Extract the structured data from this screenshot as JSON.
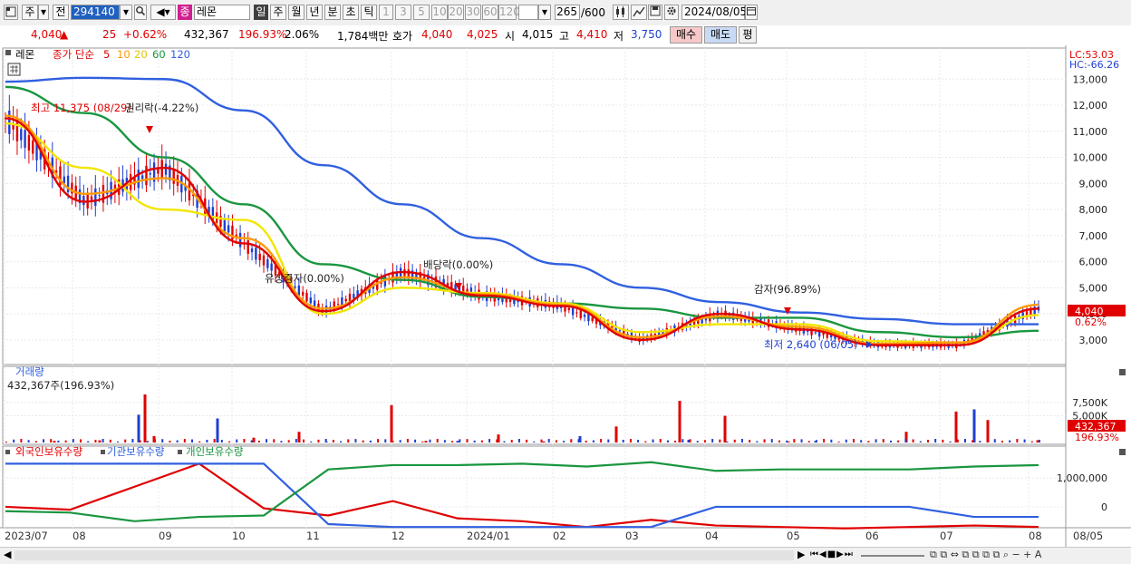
{
  "toolbar": {
    "market": "주",
    "scope": "전",
    "code": "294140",
    "badge": "종",
    "stock_name": "레몬",
    "period_buttons": [
      "일",
      "주",
      "월",
      "년",
      "분",
      "초",
      "틱"
    ],
    "interval_buttons": [
      "1",
      "3",
      "5",
      "10",
      "20",
      "30",
      "60",
      "120"
    ],
    "count": "265",
    "count_total": "/600",
    "date": "2024/08/05"
  },
  "quote": {
    "price": "4,040",
    "change": "25",
    "change_pct": "+0.62%",
    "volume": "432,367",
    "volume_ratio": "196.93%",
    "turnover_pct": "2.06%",
    "amount": "1,784백만",
    "ask_label": "호가",
    "ask1": "4,040",
    "ask2": "4,025",
    "open_label": "시",
    "open": "4,015",
    "high_label": "고",
    "high": "4,410",
    "low_label": "저",
    "low": "3,750",
    "buy": "매수",
    "sell": "매도",
    "eval": "평"
  },
  "price_panel": {
    "legend_name": "레몬",
    "legend_ma": "종가 단순",
    "ma_periods": [
      "5",
      "10",
      "20",
      "60",
      "120"
    ],
    "ma_colors": [
      "#e00000",
      "#ff9900",
      "#f2e600",
      "#1a9640",
      "#3060e0"
    ],
    "lc": "LC:53.03",
    "hc": "HC:-66.26",
    "last_price_label": "4,040",
    "last_change_label": "0.62%",
    "annotations": {
      "high": "최고 11,375 (08/29)",
      "div1": "권리락(-4.22%)",
      "div2": "유상증자(0.00%)",
      "div3": "배당락(0.00%)",
      "div4": "감자(96.89%)",
      "low": "최저 2,640 (06/05)"
    }
  },
  "volume_panel": {
    "title": "거래량",
    "value": "432,367주(196.93%)",
    "last_label": "432,367",
    "last_pct": "196.93%"
  },
  "holding_panel": {
    "labels": [
      "외국인보유수량",
      "기관보유수량",
      "개인보유수량"
    ],
    "colors": [
      "#e00000",
      "#3060e0",
      "#1a9640"
    ]
  },
  "x_axis": {
    "labels": [
      "2023/07",
      "08",
      "09",
      "10",
      "11",
      "12",
      "2024/01",
      "02",
      "03",
      "04",
      "05",
      "06",
      "07",
      "08"
    ],
    "last_date": "08/05"
  },
  "chart_data": [
    {
      "type": "line",
      "title": "",
      "ylabel": "",
      "ylim": [
        2300,
        13600
      ],
      "y_ticks": [
        "3,000",
        "4,000",
        "5,000",
        "6,000",
        "7,000",
        "8,000",
        "9,000",
        "10,000",
        "11,000",
        "12,000",
        "13,000"
      ],
      "y_tick_values": [
        3000,
        4000,
        5000,
        6000,
        7000,
        8000,
        9000,
        10000,
        11000,
        12000,
        13000
      ],
      "x": [
        "2023-07",
        "08",
        "09",
        "10",
        "11",
        "12",
        "2024-01",
        "02",
        "03",
        "04",
        "05",
        "06",
        "07",
        "08"
      ],
      "series": [
        {
          "name": "5",
          "values": [
            11500,
            8300,
            9600,
            6700,
            4100,
            5600,
            4700,
            4300,
            3000,
            4000,
            3400,
            2800,
            2800,
            4200
          ]
        },
        {
          "name": "10",
          "values": [
            11600,
            8600,
            9200,
            6900,
            4200,
            5400,
            4750,
            4350,
            3100,
            3900,
            3500,
            2850,
            2900,
            4350
          ]
        },
        {
          "name": "20",
          "values": [
            11300,
            9600,
            8000,
            7600,
            4000,
            5000,
            4800,
            4400,
            3300,
            3600,
            3600,
            2950,
            2900,
            3950
          ]
        },
        {
          "name": "60",
          "values": [
            12700,
            11700,
            10000,
            8200,
            5900,
            5300,
            4650,
            4400,
            4200,
            3850,
            3850,
            3300,
            3100,
            3350
          ]
        },
        {
          "name": "120",
          "values": [
            12900,
            13050,
            13000,
            11800,
            9700,
            8200,
            6900,
            5900,
            5000,
            4450,
            4050,
            3800,
            3600,
            3600
          ]
        }
      ]
    },
    {
      "type": "bar",
      "title": "거래량",
      "ylim": [
        0,
        9000
      ],
      "y_ticks": [
        "5,000K",
        "7,500K"
      ],
      "y_tick_values": [
        5000,
        7500
      ],
      "values_k": [
        300,
        400,
        5200,
        9000,
        1200,
        4500,
        900,
        2000,
        200,
        7000,
        300,
        300,
        1500,
        200,
        1200,
        3000,
        7800,
        500,
        5000,
        200,
        300,
        2000,
        5800,
        6200,
        4200,
        432
      ]
    },
    {
      "type": "line",
      "title": "외국인보유수량 기관보유수량 개인보유수량",
      "ylim": [
        -600000,
        1700000
      ],
      "y_ticks": [
        "0",
        "1,000,000"
      ],
      "y_tick_values": [
        0,
        1000000
      ],
      "series": [
        {
          "name": "외국인보유수량",
          "values": [
            0,
            -100000,
            700000,
            1500000,
            -50000,
            -300000,
            200000,
            -400000,
            -500000,
            -700000,
            -450000,
            -650000,
            -700000,
            -750000,
            -700000,
            -650000,
            -700000
          ]
        },
        {
          "name": "기관보유수량",
          "values": [
            1500000,
            1500000,
            1500000,
            1500000,
            1500000,
            -600000,
            -700000,
            -700000,
            -700000,
            -700000,
            -700000,
            0,
            0,
            0,
            0,
            -350000,
            -350000
          ]
        },
        {
          "name": "개인보유수량",
          "values": [
            -150000,
            -200000,
            -500000,
            -350000,
            -300000,
            1300000,
            1450000,
            1450000,
            1500000,
            1400000,
            1550000,
            1250000,
            1300000,
            1300000,
            1300000,
            1400000,
            1450000
          ]
        }
      ]
    }
  ]
}
